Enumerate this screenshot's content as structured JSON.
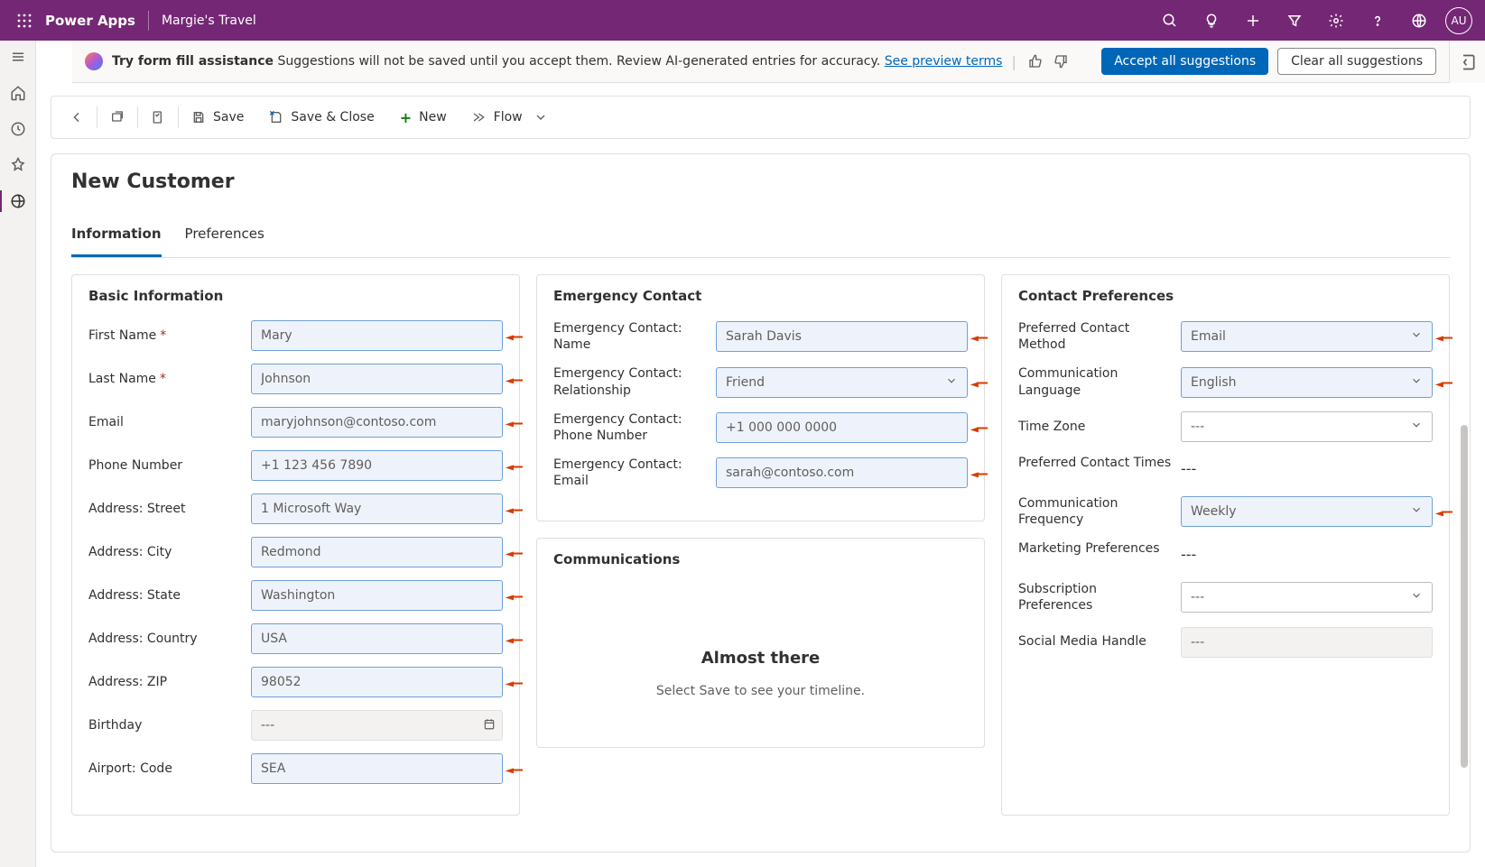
{
  "topbar": {
    "brand": "Power Apps",
    "app_name": "Margie's Travel",
    "avatar": "AU"
  },
  "banner": {
    "bold": "Try form fill assistance",
    "text": " Suggestions will not be saved until you accept them. Review AI-generated entries for accuracy. ",
    "link": "See preview terms",
    "accept": "Accept all suggestions",
    "clear": "Clear all suggestions"
  },
  "cmdbar": {
    "save": "Save",
    "save_close": "Save & Close",
    "new": "New",
    "flow": "Flow"
  },
  "page": {
    "title": "New Customer",
    "tabs": {
      "information": "Information",
      "preferences": "Preferences"
    }
  },
  "sections": {
    "basic": {
      "title": "Basic Information",
      "first_name_label": "First Name",
      "first_name": "Mary",
      "last_name_label": "Last Name",
      "last_name": "Johnson",
      "email_label": "Email",
      "email": "maryjohnson@contoso.com",
      "phone_label": "Phone Number",
      "phone": "+1 123 456 7890",
      "street_label": "Address: Street",
      "street": "1 Microsoft Way",
      "city_label": "Address: City",
      "city": "Redmond",
      "state_label": "Address: State",
      "state": "Washington",
      "country_label": "Address: Country",
      "country": "USA",
      "zip_label": "Address: ZIP",
      "zip": "98052",
      "birthday_label": "Birthday",
      "birthday": "---",
      "airport_label": "Airport: Code",
      "airport": "SEA"
    },
    "emergency": {
      "title": "Emergency Contact",
      "name_label": "Emergency Contact: Name",
      "name": "Sarah Davis",
      "rel_label": "Emergency Contact: Relationship",
      "rel": "Friend",
      "phone_label": "Emergency Contact: Phone Number",
      "phone": "+1 000 000 0000",
      "email_label": "Emergency Contact: Email",
      "email": "sarah@contoso.com"
    },
    "communications": {
      "title": "Communications",
      "headline": "Almost there",
      "sub": "Select Save to see your timeline."
    },
    "prefs": {
      "title": "Contact Preferences",
      "method_label": "Preferred Contact Method",
      "method": "Email",
      "lang_label": "Communication Language",
      "lang": "English",
      "tz_label": "Time Zone",
      "tz": "---",
      "times_label": "Preferred Contact Times",
      "times": "---",
      "freq_label": "Communication Frequency",
      "freq": "Weekly",
      "marketing_label": "Marketing Preferences",
      "marketing": "---",
      "sub_label": "Subscription Preferences",
      "sub": "---",
      "social_label": "Social Media Handle",
      "social": "---"
    }
  }
}
